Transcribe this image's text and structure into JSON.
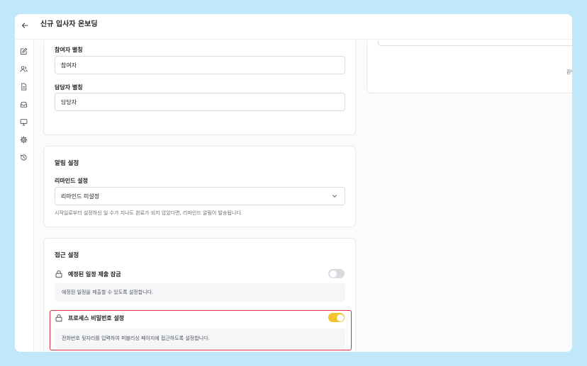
{
  "header": {
    "title": "신규 입사자 온보딩"
  },
  "sidebar": {
    "items": [
      {
        "icon": "edit-icon"
      },
      {
        "icon": "users-icon"
      },
      {
        "icon": "document-icon"
      },
      {
        "icon": "inbox-icon"
      },
      {
        "icon": "monitor-icon"
      },
      {
        "icon": "gear-icon"
      },
      {
        "icon": "history-icon"
      }
    ]
  },
  "participants": {
    "participant_alias_label": "참여자 별칭",
    "participant_alias_value": "참여자",
    "manager_alias_label": "담당자 별칭",
    "manager_alias_value": "담당자"
  },
  "notifications": {
    "title": "알림 설정",
    "reminder_label": "리마인드 설정",
    "reminder_value": "리마인드 미설정",
    "reminder_help": "시작일로부터 설정하신 일 수가 지나도 완료가 되지 않았다면, 리마인드 알림이 발송됩니다."
  },
  "access": {
    "title": "접근 설정",
    "schedule_lock_title": "예정된 일정 제출 잠금",
    "schedule_lock_desc": "예정된 일정을 제출할 수 있도록 설정합니다.",
    "schedule_lock_on": false,
    "password_title": "프로세스 비밀번호 설정",
    "password_desc": "전화번호 뒷자리를 입력하여 퍼블리싱 페이지에 접근하도록 설정합니다.",
    "password_on": true
  },
  "right_panel": {
    "partial_text": "환인"
  },
  "colors": {
    "background": "#bfe9fb",
    "toggle_on": "#f2c230",
    "toggle_off": "#d7dadf",
    "highlight": "#d92d3a"
  }
}
